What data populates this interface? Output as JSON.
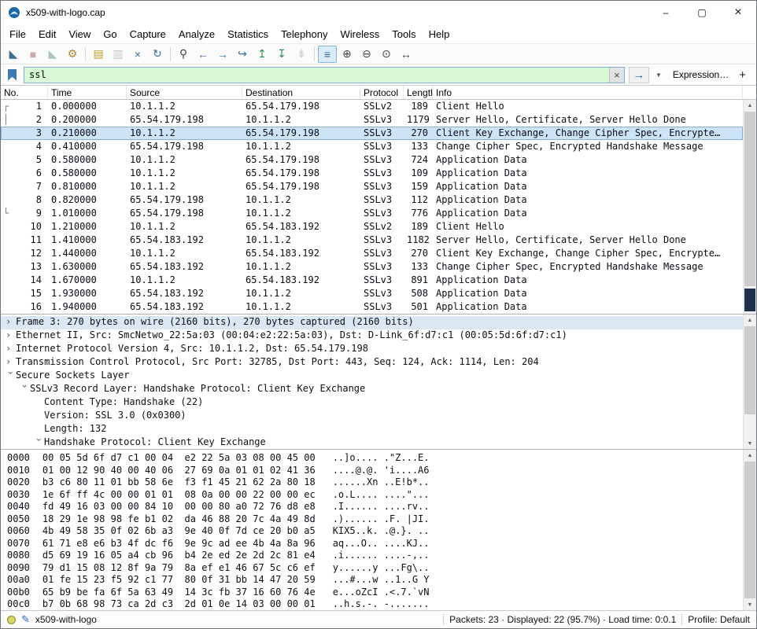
{
  "window": {
    "title": "x509-with-logo.cap",
    "controls": {
      "minimize": "–",
      "maximize": "▢",
      "close": "×"
    }
  },
  "icons": {
    "up": "▲",
    "down": "▼",
    "comment": "✎"
  },
  "colors": {
    "filter_valid_bg": "#d8f8d6",
    "selected_row_bg": "#cde3f6",
    "accent_blue": "#2b6cb0",
    "scroll_map": "#20304a"
  },
  "menu": {
    "items": [
      "File",
      "Edit",
      "View",
      "Go",
      "Capture",
      "Analyze",
      "Statistics",
      "Telephony",
      "Wireless",
      "Tools",
      "Help"
    ]
  },
  "toolbar": {
    "buttons": [
      {
        "name": "start-capture",
        "glyph": "◣",
        "color": "#3a6d91"
      },
      {
        "name": "stop-capture",
        "glyph": "■",
        "color": "#833",
        "enabled": false
      },
      {
        "name": "restart-capture",
        "glyph": "◣",
        "color": "#3e7a52",
        "enabled": false
      },
      {
        "name": "capture-options",
        "glyph": "⚙",
        "color": "#a8862c"
      },
      {
        "sep": true
      },
      {
        "name": "open-file",
        "glyph": "▤",
        "color": "#c2992f"
      },
      {
        "name": "save-file",
        "glyph": "▥",
        "color": "#6a7681",
        "enabled": false
      },
      {
        "name": "close-file",
        "glyph": "×",
        "color": "#3b6ea5"
      },
      {
        "name": "reload-file",
        "glyph": "↻",
        "color": "#3b6ea5"
      },
      {
        "sep": true
      },
      {
        "name": "find-packet",
        "glyph": "⚲",
        "color": "#444444"
      },
      {
        "name": "go-back",
        "glyph": "←",
        "color": "#3b6ea5"
      },
      {
        "name": "go-forward",
        "glyph": "→",
        "color": "#3b6ea5"
      },
      {
        "name": "go-to-packet",
        "glyph": "↪",
        "color": "#3b6ea5"
      },
      {
        "name": "go-first-packet",
        "glyph": "↥",
        "color": "#2e8b57"
      },
      {
        "name": "go-last-packet",
        "glyph": "↧",
        "color": "#2e8b57"
      },
      {
        "name": "auto-scroll",
        "glyph": "⇟",
        "color": "#888888",
        "enabled": false
      },
      {
        "sep": true
      },
      {
        "name": "colorize-packets",
        "glyph": "≡",
        "color": "#3b6ea5",
        "pressed": true
      },
      {
        "name": "zoom-in",
        "glyph": "⊕",
        "color": "#444444"
      },
      {
        "name": "zoom-out",
        "glyph": "⊖",
        "color": "#444444"
      },
      {
        "name": "zoom-original",
        "glyph": "⊙",
        "color": "#444444"
      },
      {
        "name": "resize-columns",
        "glyph": "↔",
        "color": "#444444"
      }
    ]
  },
  "filter": {
    "value": "ssl",
    "clear": "×",
    "apply": "→",
    "dropdown": "▼",
    "expression": "Expression…",
    "add": "+"
  },
  "packet_list": {
    "columns": [
      "No.",
      "Time",
      "Source",
      "Destination",
      "Protocol",
      "Length",
      "Info"
    ],
    "rows": [
      {
        "mark": "┌",
        "no": "1",
        "time": "0.000000",
        "source": "10.1.1.2",
        "destination": "65.54.179.198",
        "protocol": "SSLv2",
        "length": "189",
        "info": "Client Hello"
      },
      {
        "mark": "│",
        "no": "2",
        "time": "0.200000",
        "source": "65.54.179.198",
        "destination": "10.1.1.2",
        "protocol": "SSLv3",
        "length": "1179",
        "info": "Server Hello, Certificate, Server Hello Done"
      },
      {
        "mark": "",
        "no": "3",
        "time": "0.210000",
        "source": "10.1.1.2",
        "destination": "65.54.179.198",
        "protocol": "SSLv3",
        "length": "270",
        "info": "Client Key Exchange, Change Cipher Spec, Encrypte…",
        "selected": true
      },
      {
        "mark": "",
        "no": "4",
        "time": "0.410000",
        "source": "65.54.179.198",
        "destination": "10.1.1.2",
        "protocol": "SSLv3",
        "length": "133",
        "info": "Change Cipher Spec, Encrypted Handshake Message"
      },
      {
        "mark": "",
        "no": "5",
        "time": "0.580000",
        "source": "10.1.1.2",
        "destination": "65.54.179.198",
        "protocol": "SSLv3",
        "length": "724",
        "info": "Application Data"
      },
      {
        "mark": "",
        "no": "6",
        "time": "0.580000",
        "source": "10.1.1.2",
        "destination": "65.54.179.198",
        "protocol": "SSLv3",
        "length": "109",
        "info": "Application Data"
      },
      {
        "mark": "",
        "no": "7",
        "time": "0.810000",
        "source": "10.1.1.2",
        "destination": "65.54.179.198",
        "protocol": "SSLv3",
        "length": "159",
        "info": "Application Data"
      },
      {
        "mark": "",
        "no": "8",
        "time": "0.820000",
        "source": "65.54.179.198",
        "destination": "10.1.1.2",
        "protocol": "SSLv3",
        "length": "112",
        "info": "Application Data"
      },
      {
        "mark": "└",
        "no": "9",
        "time": "1.010000",
        "source": "65.54.179.198",
        "destination": "10.1.1.2",
        "protocol": "SSLv3",
        "length": "776",
        "info": "Application Data"
      },
      {
        "mark": "",
        "no": "10",
        "time": "1.210000",
        "source": "10.1.1.2",
        "destination": "65.54.183.192",
        "protocol": "SSLv2",
        "length": "189",
        "info": "Client Hello"
      },
      {
        "mark": "",
        "no": "11",
        "time": "1.410000",
        "source": "65.54.183.192",
        "destination": "10.1.1.2",
        "protocol": "SSLv3",
        "length": "1182",
        "info": "Server Hello, Certificate, Server Hello Done"
      },
      {
        "mark": "",
        "no": "12",
        "time": "1.440000",
        "source": "10.1.1.2",
        "destination": "65.54.183.192",
        "protocol": "SSLv3",
        "length": "270",
        "info": "Client Key Exchange, Change Cipher Spec, Encrypte…"
      },
      {
        "mark": "",
        "no": "13",
        "time": "1.630000",
        "source": "65.54.183.192",
        "destination": "10.1.1.2",
        "protocol": "SSLv3",
        "length": "133",
        "info": "Change Cipher Spec, Encrypted Handshake Message"
      },
      {
        "mark": "",
        "no": "14",
        "time": "1.670000",
        "source": "10.1.1.2",
        "destination": "65.54.183.192",
        "protocol": "SSLv3",
        "length": "891",
        "info": "Application Data"
      },
      {
        "mark": "",
        "no": "15",
        "time": "1.930000",
        "source": "65.54.183.192",
        "destination": "10.1.1.2",
        "protocol": "SSLv3",
        "length": "508",
        "info": "Application Data"
      },
      {
        "mark": "",
        "no": "16",
        "time": "1.940000",
        "source": "65.54.183.192",
        "destination": "10.1.1.2",
        "protocol": "SSLv3",
        "length": "501",
        "info": "Application Data"
      }
    ]
  },
  "details": {
    "lines": [
      {
        "indent": 0,
        "expand": "closed",
        "selected": true,
        "text": "Frame 3: 270 bytes on wire (2160 bits), 270 bytes captured (2160 bits)"
      },
      {
        "indent": 0,
        "expand": "closed",
        "text": "Ethernet II, Src: SmcNetwo_22:5a:03 (00:04:e2:22:5a:03), Dst: D-Link_6f:d7:c1 (00:05:5d:6f:d7:c1)"
      },
      {
        "indent": 0,
        "expand": "closed",
        "text": "Internet Protocol Version 4, Src: 10.1.1.2, Dst: 65.54.179.198"
      },
      {
        "indent": 0,
        "expand": "closed",
        "text": "Transmission Control Protocol, Src Port: 32785, Dst Port: 443, Seq: 124, Ack: 1114, Len: 204"
      },
      {
        "indent": 0,
        "expand": "open",
        "text": "Secure Sockets Layer"
      },
      {
        "indent": 1,
        "expand": "open",
        "text": "SSLv3 Record Layer: Handshake Protocol: Client Key Exchange"
      },
      {
        "indent": 2,
        "expand": "none",
        "text": "Content Type: Handshake (22)"
      },
      {
        "indent": 2,
        "expand": "none",
        "text": "Version: SSL 3.0 (0x0300)"
      },
      {
        "indent": 2,
        "expand": "none",
        "text": "Length: 132"
      },
      {
        "indent": 2,
        "expand": "open",
        "text": "Handshake Protocol: Client Key Exchange"
      }
    ]
  },
  "hex": {
    "lines": [
      {
        "offset": "0000",
        "bytes": "00 05 5d 6f d7 c1 00 04  e2 22 5a 03 08 00 45 00",
        "ascii": "..]o.... .\"Z...E."
      },
      {
        "offset": "0010",
        "bytes": "01 00 12 90 40 00 40 06  27 69 0a 01 01 02 41 36",
        "ascii": "....@.@. 'i....A6"
      },
      {
        "offset": "0020",
        "bytes": "b3 c6 80 11 01 bb 58 6e  f3 f1 45 21 62 2a 80 18",
        "ascii": "......Xn ..E!b*.."
      },
      {
        "offset": "0030",
        "bytes": "1e 6f ff 4c 00 00 01 01  08 0a 00 00 22 00 00 ec",
        "ascii": ".o.L.... ....\"..."
      },
      {
        "offset": "0040",
        "bytes": "fd 49 16 03 00 00 84 10  00 00 80 a0 72 76 d8 e8",
        "ascii": ".I...... ....rv.."
      },
      {
        "offset": "0050",
        "bytes": "18 29 1e 98 98 fe b1 02  da 46 88 20 7c 4a 49 8d",
        "ascii": ".)...... .F. |JI."
      },
      {
        "offset": "0060",
        "bytes": "4b 49 58 35 0f 02 6b a3  9e 40 0f 7d ce 20 b0 a5",
        "ascii": "KIX5..k. .@.}. .."
      },
      {
        "offset": "0070",
        "bytes": "61 71 e8 e6 b3 4f dc f6  9e 9c ad ee 4b 4a 8a 96",
        "ascii": "aq...O.. ....KJ.."
      },
      {
        "offset": "0080",
        "bytes": "d5 69 19 16 05 a4 cb 96  b4 2e ed 2e 2d 2c 81 e4",
        "ascii": ".i...... ....-,.."
      },
      {
        "offset": "0090",
        "bytes": "79 d1 15 08 12 8f 9a 79  8a ef e1 46 67 5c c6 ef",
        "ascii": "y......y ...Fg\\.."
      },
      {
        "offset": "00a0",
        "bytes": "01 fe 15 23 f5 92 c1 77  80 0f 31 bb 14 47 20 59",
        "ascii": "...#...w ..1..G Y"
      },
      {
        "offset": "00b0",
        "bytes": "65 b9 be fa 6f 5a 63 49  14 3c fb 37 16 60 76 4e",
        "ascii": "e...oZcI .<.7.`vN"
      },
      {
        "offset": "00c0",
        "bytes": "b7 0b 68 98 73 ca 2d c3  2d 01 0e 14 03 00 00 01",
        "ascii": "..h.s.-. -......."
      }
    ]
  },
  "status": {
    "filename": "x509-with-logo",
    "packets_info": "Packets: 23 · Displayed: 22 (95.7%) · Load time: 0:0.1",
    "profile": "Profile: Default"
  }
}
